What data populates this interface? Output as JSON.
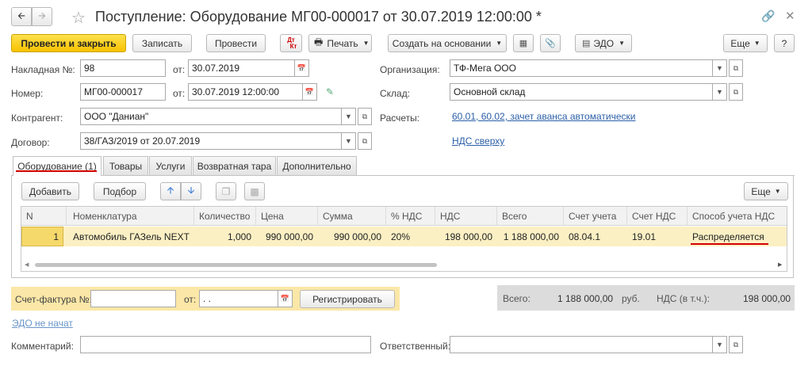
{
  "window": {
    "title": "Поступление: Оборудование МГ00-000017 от 30.07.2019 12:00:00 *",
    "star_icon": "star-icon",
    "link_icon": "link-icon",
    "close_icon": "close-icon"
  },
  "toolbar": {
    "post_close": "Провести и закрыть",
    "save": "Записать",
    "post": "Провести",
    "dt_kt_top": "Дт",
    "dt_kt_bottom": "Кт",
    "print": "Печать",
    "create_based": "Создать на основании",
    "edo": "ЭДО",
    "more": "Еще",
    "help": "?"
  },
  "form": {
    "invoice_no_label": "Накладная  №:",
    "invoice_no": "98",
    "invoice_date_label": "от:",
    "invoice_date": "30.07.2019",
    "number_label": "Номер:",
    "number": "МГ00-000017",
    "number_date_label": "от:",
    "number_date": "30.07.2019 12:00:00",
    "contractor_label": "Контрагент:",
    "contractor": "ООО \"Даниан\"",
    "contract_label": "Договор:",
    "contract": "38/ГАЗ/2019 от 20.07.2019",
    "org_label": "Организация:",
    "org": "ТФ-Мега ООО",
    "warehouse_label": "Склад:",
    "warehouse": "Основной склад",
    "settlements_label": "Расчеты:",
    "settlements_link": "60.01, 60.02, зачет аванса автоматически",
    "vat_link": "НДС сверху"
  },
  "tabs": [
    "Оборудование (1)",
    "Товары",
    "Услуги",
    "Возвратная тара",
    "Дополнительно"
  ],
  "table_toolbar": {
    "add": "Добавить",
    "pick": "Подбор",
    "more": "Еще"
  },
  "table": {
    "headers": [
      "N",
      "Номенклатура",
      "Количество",
      "Цена",
      "Сумма",
      "% НДС",
      "НДС",
      "Всего",
      "Счет учета",
      "Счет НДС",
      "Способ учета НДС"
    ],
    "rows": [
      [
        "1",
        "Автомобиль ГАЗель NEXT",
        "1,000",
        "990 000,00",
        "990 000,00",
        "20%",
        "198 000,00",
        "1 188 000,00",
        "08.04.1",
        "19.01",
        "Распределяется"
      ]
    ]
  },
  "footer": {
    "invoice_label": "Счет-фактура №:",
    "invoice_value": "",
    "date_label": "от:",
    "date_value": " .  .",
    "register": "Регистрировать",
    "total_label": "Всего:",
    "total_value": "1 188 000,00",
    "currency": "руб.",
    "vat_label": "НДС (в т.ч.):",
    "vat_value": "198 000,00",
    "edo_status": "ЭДО не начат",
    "comment_label": "Комментарий:",
    "comment_value": "",
    "responsible_label": "Ответственный:",
    "responsible_value": ""
  },
  "colors": {
    "accent_yellow": "#f7c200",
    "highlight_row": "#fbf0c4",
    "underline_red": "#d40000",
    "link": "#2b5fa8"
  }
}
